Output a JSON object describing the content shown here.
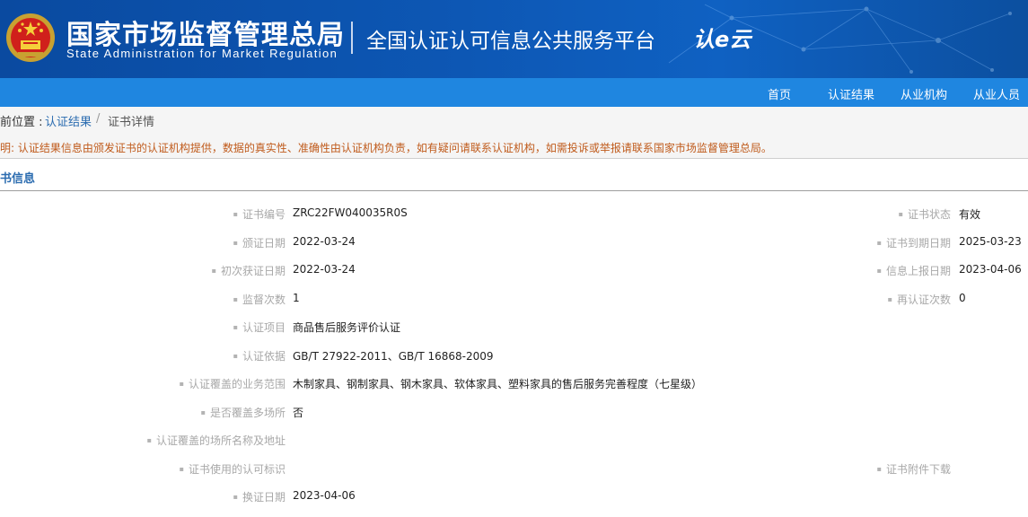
{
  "header": {
    "org_name_cn": "国家市场监督管理总局",
    "org_name_en": "State Administration  for  Market Regulation",
    "platform_title": "全国认证认可信息公共服务平台",
    "platform_logo": "认e云",
    "brand_color": "#0d57b4"
  },
  "nav": {
    "items": [
      {
        "label": "首页"
      },
      {
        "label": "认证结果"
      },
      {
        "label": "从业机构"
      },
      {
        "label": "从业人员"
      }
    ]
  },
  "breadcrumb": {
    "prefix": "前位置 :",
    "link": "认证结果",
    "separator": "/",
    "current": "证书详情"
  },
  "notice": "明: 认证结果信息由颁发证书的认证机构提供，数据的真实性、准确性由认证机构负责，如有疑问请联系认证机构，如需投诉或举报请联系国家市场监督管理总局。",
  "section_title": "书信息",
  "details": {
    "cert_no": {
      "label": "证书编号",
      "value": "ZRC22FW040035R0S"
    },
    "cert_status": {
      "label": "证书状态",
      "value": "有效"
    },
    "issue_date": {
      "label": "颁证日期",
      "value": "2022-03-24"
    },
    "expiry_date": {
      "label": "证书到期日期",
      "value": "2025-03-23"
    },
    "first_date": {
      "label": "初次获证日期",
      "value": "2022-03-24"
    },
    "report_date": {
      "label": "信息上报日期",
      "value": "2023-04-06"
    },
    "supervision": {
      "label": "监督次数",
      "value": "1"
    },
    "recert_count": {
      "label": "再认证次数",
      "value": "0"
    },
    "project": {
      "label": "认证项目",
      "value": "商品售后服务评价认证"
    },
    "basis": {
      "label": "认证依据",
      "value": "GB/T 27922-2011、GB/T 16868-2009"
    },
    "scope": {
      "label": "认证覆盖的业务范围",
      "value": "木制家具、钢制家具、钢木家具、软体家具、塑料家具的售后服务完善程度（七星级）"
    },
    "multi_site": {
      "label": "是否覆盖多场所",
      "value": "否"
    },
    "site_address": {
      "label": "认证覆盖的场所名称及地址"
    },
    "cert_mark": {
      "label": "证书使用的认可标识"
    },
    "attachment": {
      "label": "证书附件下载"
    },
    "renew_date": {
      "label": "换证日期",
      "value": "2023-04-06"
    }
  }
}
